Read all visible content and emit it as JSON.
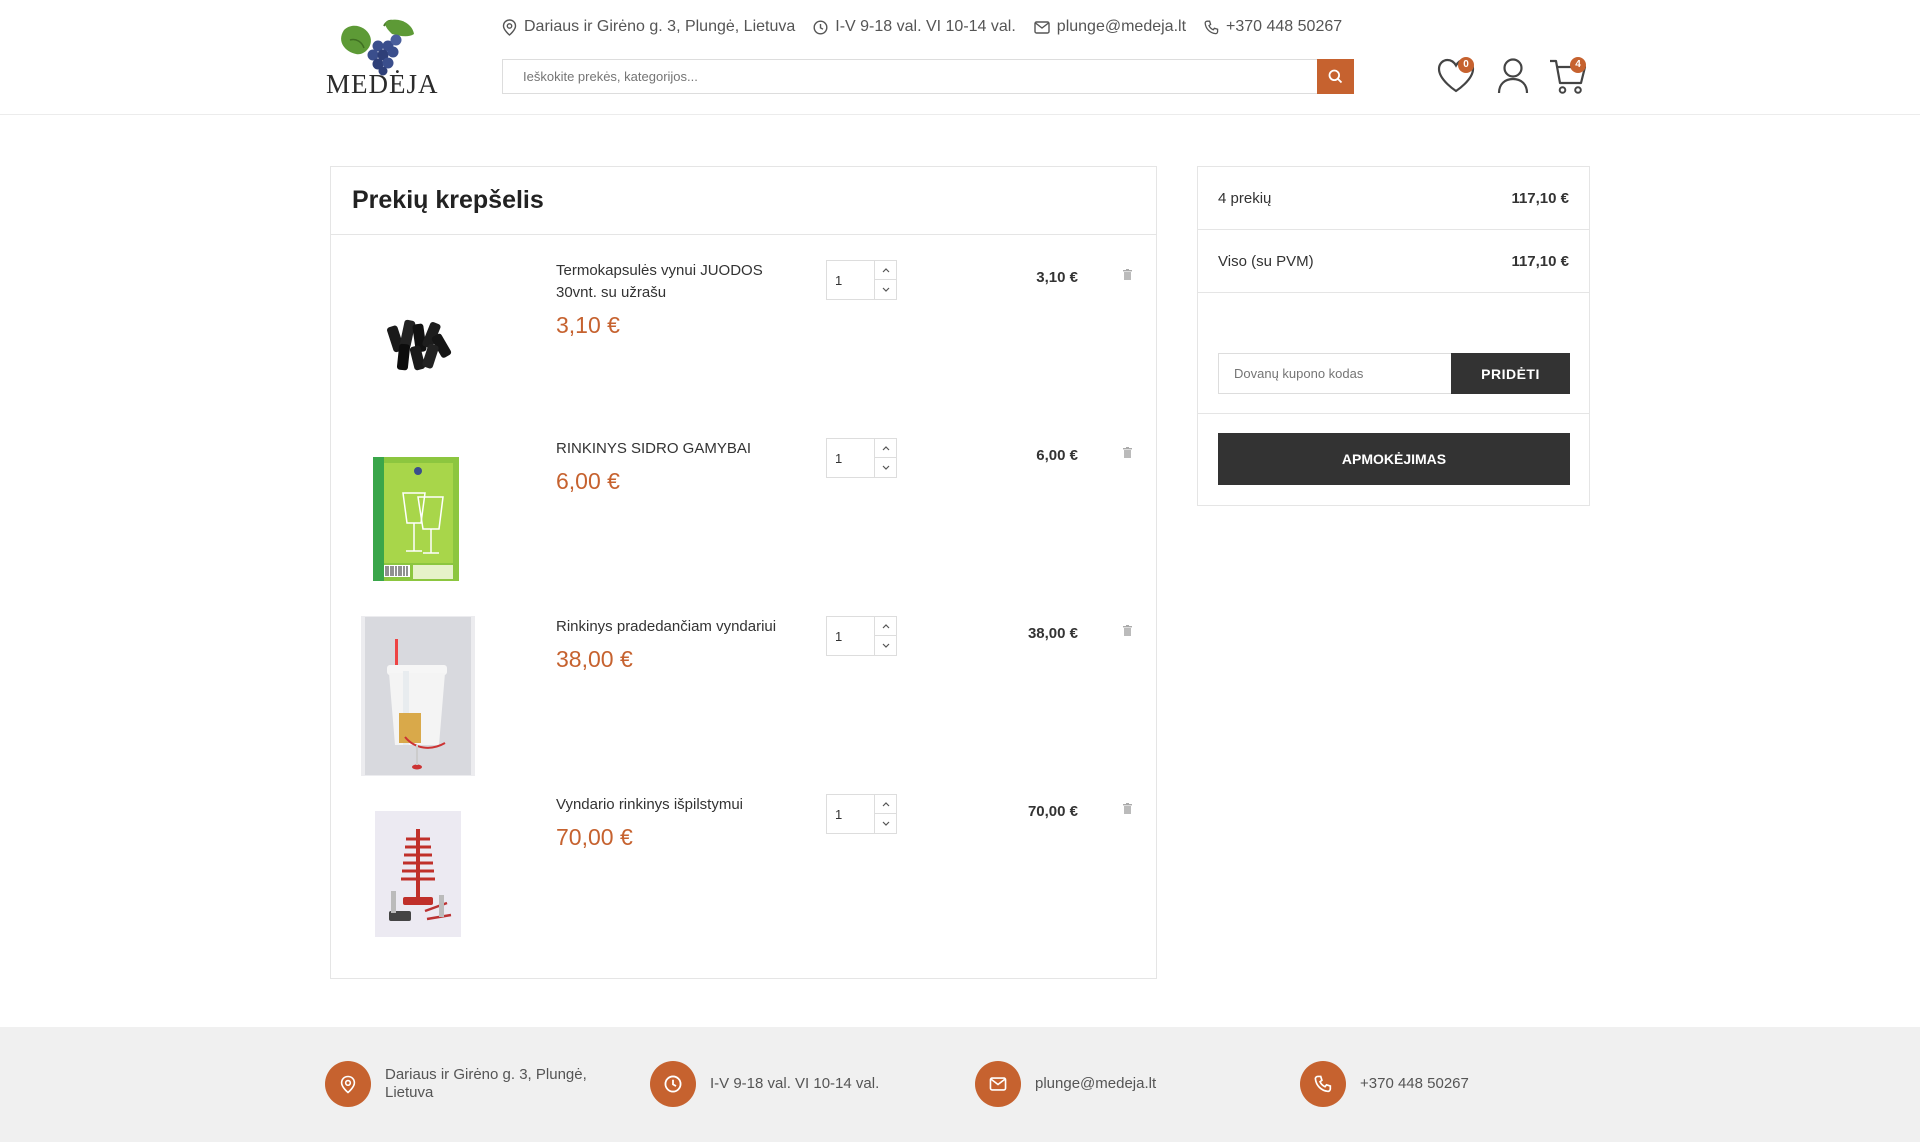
{
  "header": {
    "logo_text": "MEDĖJA",
    "address": "Dariaus ir Girėno g. 3, Plungė, Lietuva",
    "hours": "I-V 9-18 val. VI 10-14 val.",
    "email": "plunge@medeja.lt",
    "phone": "+370 448 50267",
    "search_placeholder": "Ieškokite prekės, kategorijos...",
    "wishlist_count": "0",
    "cart_count": "4"
  },
  "cart": {
    "title": "Prekių krepšelis",
    "items": [
      {
        "name": "Termokapsulės vynui JUODOS 30vnt. su užrašu",
        "price": "3,10 €",
        "qty": "1",
        "total": "3,10 €",
        "thumb": "black-capsules"
      },
      {
        "name": "RINKINYS SIDRO GAMYBAI",
        "price": "6,00 €",
        "qty": "1",
        "total": "6,00 €",
        "thumb": "cider-kit-box"
      },
      {
        "name": "Rinkinys pradedančiam vyndariui",
        "price": "38,00 €",
        "qty": "1",
        "total": "38,00 €",
        "thumb": "fermenting-bucket"
      },
      {
        "name": "Vyndario rinkinys išpilstymui",
        "price": "70,00 €",
        "qty": "1",
        "total": "70,00 €",
        "thumb": "bottling-kit"
      }
    ]
  },
  "summary": {
    "items_label": "4 prekių",
    "items_value": "117,10 €",
    "total_label": "Viso (su PVM)",
    "total_value": "117,10 €",
    "coupon_placeholder": "Dovanų kupono kodas",
    "coupon_button": "PRIDĖTI",
    "checkout_button": "APMOKĖJIMAS"
  },
  "footer": {
    "address": "Dariaus ir Girėno g. 3, Plungė, Lietuva",
    "hours": "I-V 9-18 val. VI 10-14 val.",
    "email": "plunge@medeja.lt",
    "phone": "+370 448 50267"
  },
  "colors": {
    "accent": "#c6622f",
    "dark": "#333333",
    "footer_bg": "#f0f0f0"
  }
}
